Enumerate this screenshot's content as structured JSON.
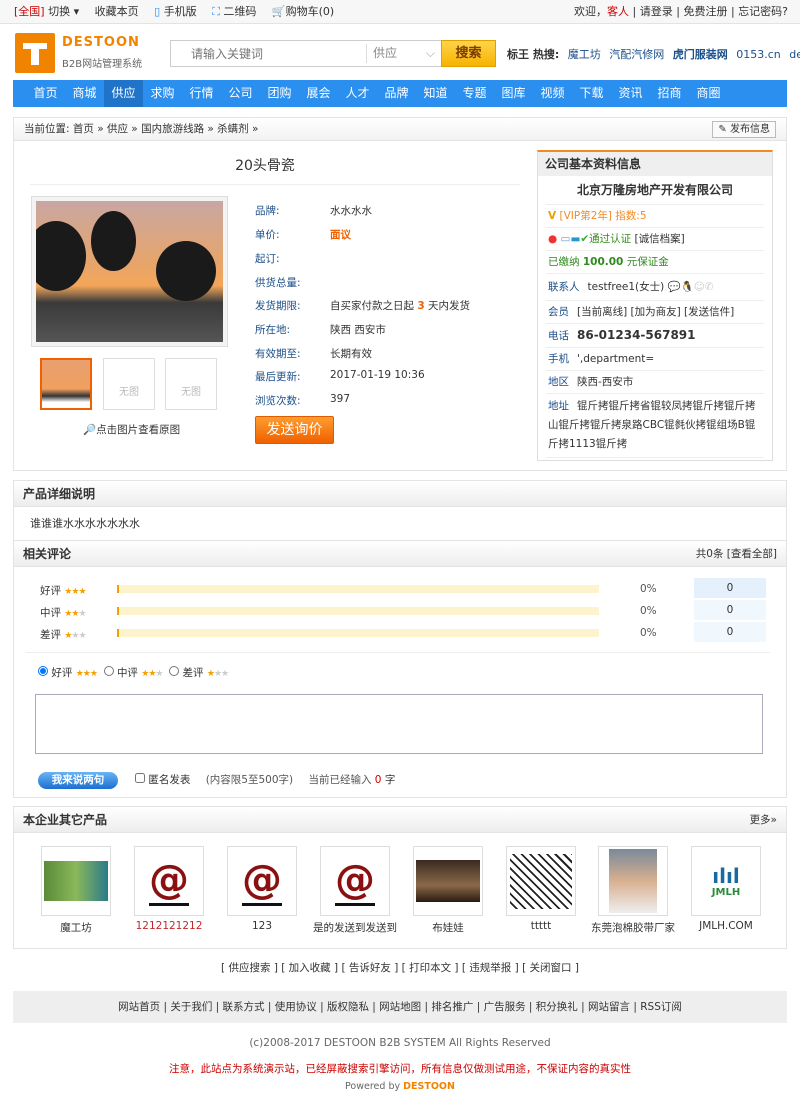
{
  "topbar": {
    "region": "[全国]",
    "switch": "切换",
    "favorite": "收藏本页",
    "mobile": "手机版",
    "qrcode": "二维码",
    "cart": "购物车(0)",
    "welcome": "欢迎，",
    "guest": "客人",
    "login": "请登录",
    "register": "免费注册",
    "forgot": "忘记密码?"
  },
  "logo": {
    "name": "DESTOON",
    "sub": "B2B网站管理系统"
  },
  "search": {
    "placeholder": "请输入关键词",
    "category": "供应",
    "button": "搜索"
  },
  "hot": {
    "label": "标王 热搜:",
    "items": [
      "魔工坊",
      "汽配汽修网",
      "虎门服装网",
      "0153.cn",
      "desto"
    ]
  },
  "nav": [
    "首页",
    "商城",
    "供应",
    "求购",
    "行情",
    "公司",
    "团购",
    "展会",
    "人才",
    "品牌",
    "知道",
    "专题",
    "图库",
    "视频",
    "下载",
    "资讯",
    "招商",
    "商圈"
  ],
  "breadcrumb": {
    "text": "当前位置: 首页 » 供应 » 国内旅游线路 » 杀螨剂 »",
    "publish": "发布信息"
  },
  "product": {
    "title": "20头骨瓷",
    "no_image": "无图",
    "zoom_hint": "点击图片查看原图",
    "inquiry": "发送询价",
    "details": [
      {
        "label": "品牌:",
        "value": "水水水水"
      },
      {
        "label": "单价:",
        "value": "面议"
      },
      {
        "label": "起订:",
        "value": ""
      },
      {
        "label": "供货总量:",
        "value": ""
      },
      {
        "label": "发货期限:",
        "value": "自买家付款之日起",
        "value_num": "3",
        "value_end": "天内发货"
      },
      {
        "label": "所在地:",
        "value": "陕西 西安市"
      },
      {
        "label": "有效期至:",
        "value": "长期有效"
      },
      {
        "label": "最后更新:",
        "value": "2017-01-19 10:36"
      },
      {
        "label": "浏览次数:",
        "value": "397"
      }
    ]
  },
  "company": {
    "header": "公司基本资料信息",
    "name": "北京万隆房地产开发有限公司",
    "vip": "[VIP第2年] 指数:5",
    "verified": "通过认证",
    "credit": "[诚信档案]",
    "deposit_pre": "已缴纳",
    "deposit": "100.00",
    "deposit_post": "元保证金",
    "contact_label": "联系人",
    "contact": "testfree1(女士)",
    "member_label": "会员",
    "member_links": "[当前离线] [加为商友] [发送信件]",
    "phone_label": "电话",
    "phone": "86-01234-567891",
    "mobile_label": "手机",
    "mobile": "',department=",
    "area_label": "地区",
    "area": "陕西-西安市",
    "address_label": "地址",
    "address": "锟斤拷锟斤拷省锟较凤拷锟斤拷锟斤拷山锟斤拷锟斤拷泉路CBC锟毵伙拷锟组场B锟斤拷1113锟斤拷"
  },
  "detail": {
    "header": "产品详细说明",
    "text": "谁谁谁水水水水水水水"
  },
  "comments": {
    "header": "相关评论",
    "summary": "共0条 [查看全部]",
    "rows": [
      {
        "label": "好评",
        "stars": 3,
        "pct": "0%",
        "count": "0"
      },
      {
        "label": "中评",
        "stars": 2,
        "pct": "0%",
        "count": "0"
      },
      {
        "label": "差评",
        "stars": 1,
        "pct": "0%",
        "count": "0"
      }
    ],
    "submit": "我来说两句",
    "anonymous": "匿名发表",
    "limit": "(内容限5至500字)",
    "typed_pre": "当前已经输入",
    "typed": "0",
    "typed_post": "字"
  },
  "others": {
    "header": "本企业其它产品",
    "more": "更多»",
    "items": [
      "魔工坊",
      "1212121212",
      "123",
      "是的发送到发送到",
      "布娃娃",
      "ttttt",
      "东莞泡棉胶带厂家",
      "JMLH.COM"
    ]
  },
  "actions": "[ 供应搜索 ] [ 加入收藏 ] [ 告诉好友 ] [ 打印本文 ] [ 违规举报 ] [ 关闭窗口 ]",
  "footer": {
    "links": "网站首页 | 关于我们 | 联系方式 | 使用协议 | 版权隐私 | 网站地图 | 排名推广 | 广告服务 | 积分换礼 | 网站留言 | RSS订阅",
    "copyright": "(c)2008-2017 DESTOON B2B SYSTEM All Rights Reserved",
    "notice": "注意，此站点为系统演示站，已经屏蔽搜索引擎访问，所有信息仅做测试用途，不保证内容的真实性",
    "powered": "Powered by",
    "powered_brand": "DESTOON"
  },
  "colors": {
    "nav": "#2b8ff0",
    "accent": "#f08300",
    "link": "#1b4f8a"
  }
}
